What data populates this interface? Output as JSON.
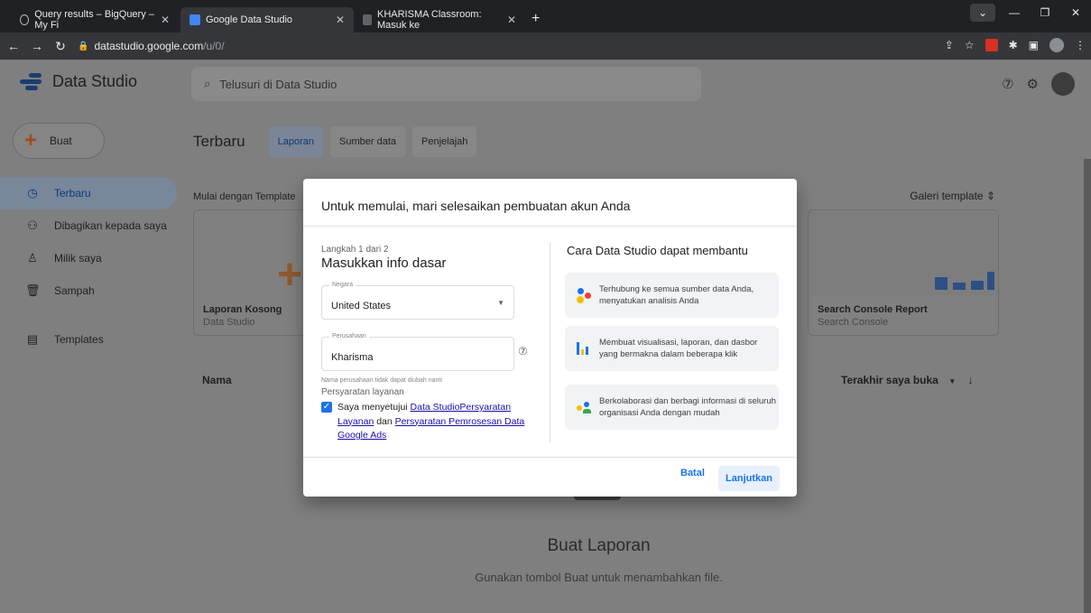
{
  "browser": {
    "tabs": [
      {
        "title": "Query results – BigQuery – My Fi"
      },
      {
        "title": "Google Data Studio"
      },
      {
        "title": "KHARISMA Classroom: Masuk ke"
      }
    ],
    "url_host": "datastudio.google.com",
    "url_path": "/u/0/"
  },
  "app": {
    "name": "Data Studio",
    "search_placeholder": "Telusuri di Data Studio"
  },
  "sidebar": {
    "create_label": "Buat",
    "items": [
      {
        "label": "Terbaru",
        "icon": "clock-icon",
        "active": true
      },
      {
        "label": "Dibagikan kepada saya",
        "icon": "shared-people-icon"
      },
      {
        "label": "Milik saya",
        "icon": "person-icon"
      },
      {
        "label": "Sampah",
        "icon": "trash-icon"
      },
      {
        "label": "Templates",
        "icon": "templates-icon"
      }
    ]
  },
  "main": {
    "recent_title": "Terbaru",
    "tabs": [
      {
        "label": "Laporan",
        "active": true
      },
      {
        "label": "Sumber data"
      },
      {
        "label": "Penjelajah"
      }
    ],
    "template_heading": "Mulai dengan Template",
    "gallery_label": "Galeri template",
    "cards": [
      {
        "title": "Laporan Kosong",
        "subtitle": "Data Studio"
      },
      {
        "title": "Search Console Report",
        "subtitle": "Search Console"
      }
    ],
    "col_name": "Nama",
    "col_sort": "Terakhir saya buka",
    "empty_title": "Buat Laporan",
    "empty_sub": "Gunakan tombol Buat untuk menambahkan file."
  },
  "modal": {
    "title": "Untuk memulai, mari selesaikan pembuatan akun Anda",
    "step": "Langkah 1 dari 2",
    "step_title": "Masukkan info dasar",
    "country_label": "Negara",
    "country_value": "United States",
    "company_label": "Perusahaan",
    "company_value": "Kharisma",
    "hint": "Nama perusahaan tidak dapat diubah nanti",
    "terms_heading": "Persyaratan layanan",
    "terms_prefix": "Saya menyetujui ",
    "terms_link1": "Data StudioPersyaratan Layanan",
    "terms_mid": " dan ",
    "terms_link2": "Persyaratan Pemrosesan Data Google Ads",
    "help_title": "Cara Data Studio dapat membantu",
    "help_items": [
      {
        "text": "Terhubung ke semua sumber data Anda, menyatukan analisis Anda"
      },
      {
        "text": "Membuat visualisasi, laporan, dan dasbor yang bermakna dalam beberapa klik"
      },
      {
        "text": "Berkolaborasi dan berbagi informasi di seluruh organisasi Anda dengan mudah"
      }
    ],
    "cancel_label": "Batal",
    "next_label": "Lanjutkan"
  },
  "colors": {
    "accent": "#1a73e8",
    "link": "#1a0dab"
  }
}
